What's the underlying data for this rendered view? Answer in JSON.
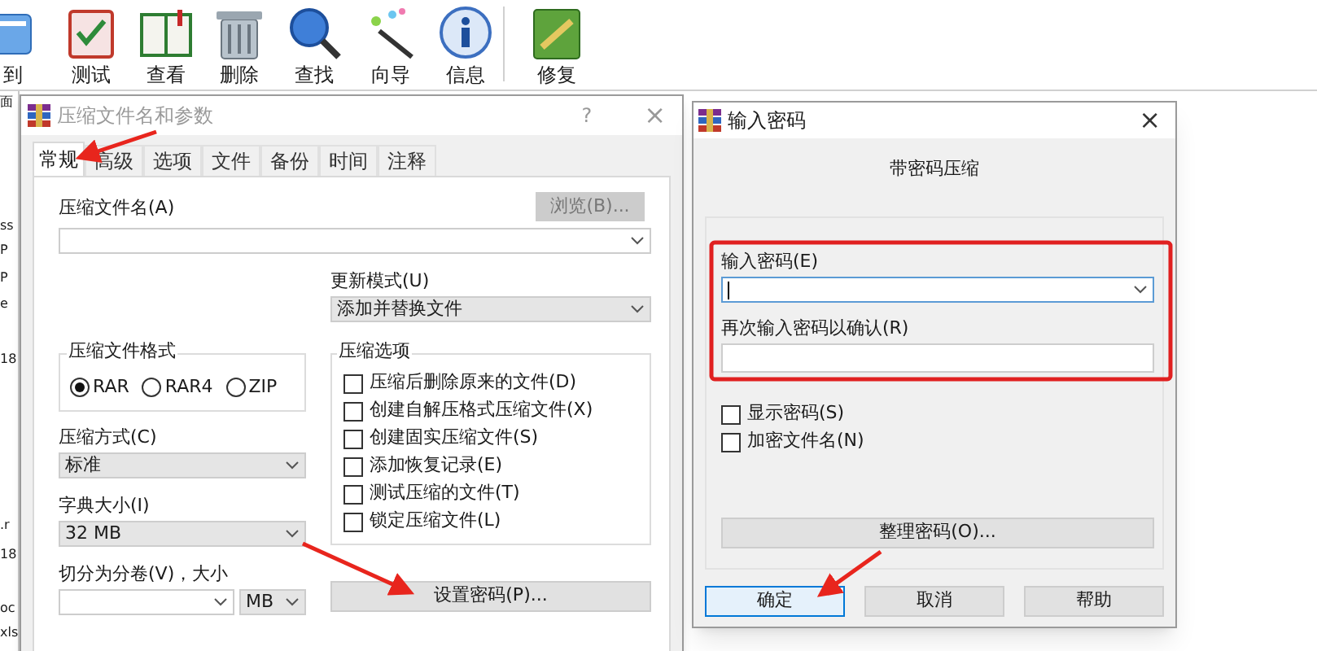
{
  "toolbar": {
    "buttons": [
      {
        "kind": "extract",
        "label": "到"
      },
      {
        "kind": "test",
        "label": "测试"
      },
      {
        "kind": "view",
        "label": "查看"
      },
      {
        "kind": "delete",
        "label": "删除"
      },
      {
        "kind": "find",
        "label": "查找"
      },
      {
        "kind": "wizard",
        "label": "向导"
      },
      {
        "kind": "info",
        "label": "信息"
      },
      {
        "kind": "repair",
        "label": "修复"
      }
    ]
  },
  "file_list": {
    "fragments": [
      "面",
      "ss",
      "P",
      "P",
      "e",
      "18",
      ".r",
      "18",
      "oc",
      "xls"
    ]
  },
  "archive_dialog": {
    "title": "压缩文件名和参数",
    "help": "?",
    "close": "×",
    "tabs": [
      {
        "label": "常规",
        "selected": true
      },
      {
        "label": "高级",
        "selected": false
      },
      {
        "label": "选项",
        "selected": false
      },
      {
        "label": "文件",
        "selected": false
      },
      {
        "label": "备份",
        "selected": false
      },
      {
        "label": "时间",
        "selected": false
      },
      {
        "label": "注释",
        "selected": false
      }
    ],
    "archive_name": {
      "label": "压缩文件名(A)",
      "browse": {
        "label": "浏览(B)...",
        "disabled": true
      }
    },
    "update_mode": {
      "label": "更新模式(U)",
      "value": "添加并替换文件"
    },
    "format": {
      "label": "压缩文件格式",
      "options": [
        {
          "label": "RAR",
          "selected": true
        },
        {
          "label": "RAR4",
          "selected": false
        },
        {
          "label": "ZIP",
          "selected": false
        }
      ]
    },
    "options": {
      "label": "压缩选项",
      "items": [
        {
          "label": "压缩后删除原来的文件(D)",
          "checked": false
        },
        {
          "label": "创建自解压格式压缩文件(X)",
          "checked": false
        },
        {
          "label": "创建固实压缩文件(S)",
          "checked": false
        },
        {
          "label": "添加恢复记录(E)",
          "checked": false
        },
        {
          "label": "测试压缩的文件(T)",
          "checked": false
        },
        {
          "label": "锁定压缩文件(L)",
          "checked": false
        }
      ]
    },
    "method": {
      "label": "压缩方式(C)",
      "value": "标准"
    },
    "dictionary": {
      "label": "字典大小(I)",
      "value": "32 MB"
    },
    "split": {
      "label": "切分为分卷(V)，大小",
      "unit": "MB"
    },
    "password_button": "设置密码(P)..."
  },
  "password_dialog": {
    "title": "输入密码",
    "close": "×",
    "heading": "带密码压缩",
    "password_label": "输入密码(E)",
    "confirm_label": "再次输入密码以确认(R)",
    "checkboxes": [
      {
        "label": "显示密码(S)",
        "checked": false
      },
      {
        "label": "加密文件名(N)",
        "checked": false
      }
    ],
    "organize_button": "整理密码(O)...",
    "buttons": [
      {
        "label": "确定",
        "default": true
      },
      {
        "label": "取消",
        "default": false
      },
      {
        "label": "帮助",
        "default": false
      }
    ]
  }
}
